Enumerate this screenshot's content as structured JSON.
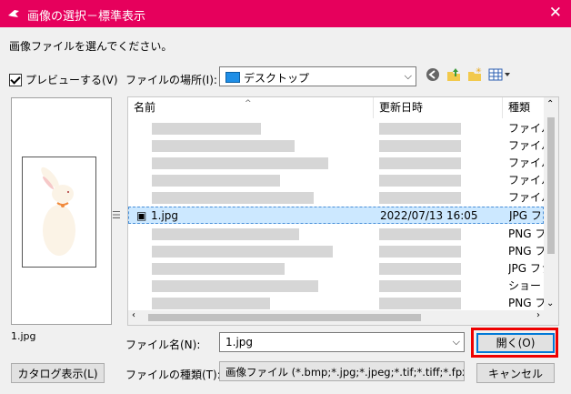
{
  "window": {
    "title": "画像の選択－標準表示",
    "close_glyph": "✕"
  },
  "instruction": "画像ファイルを選んでください。",
  "preview": {
    "checkbox_label": "プレビューする(V)",
    "file_name": "1.jpg"
  },
  "catalog_button": "カタログ表示(L)",
  "location": {
    "label": "ファイルの場所(I):",
    "value": "デスクトップ"
  },
  "toolbar_icons": [
    "back-icon",
    "up-folder-icon",
    "new-folder-icon",
    "view-menu-icon"
  ],
  "columns": {
    "name": "名前",
    "modified": "更新日時",
    "type": "種類"
  },
  "rows": [
    {
      "name": "",
      "date": "",
      "type": "ファイル"
    },
    {
      "name": "",
      "date": "",
      "type": "ファイル"
    },
    {
      "name": "",
      "date": "",
      "type": "ファイル"
    },
    {
      "name": "",
      "date": "",
      "type": "ファイル"
    },
    {
      "name": "",
      "date": "",
      "type": "ファイル"
    },
    {
      "name": "1.jpg",
      "date": "2022/07/13 16:05",
      "type": "JPG ファ"
    },
    {
      "name": "",
      "date": "",
      "type": "PNG フ"
    },
    {
      "name": "",
      "date": "",
      "type": "PNG フ"
    },
    {
      "name": "",
      "date": "",
      "type": "JPG ファ"
    },
    {
      "name": "",
      "date": "",
      "type": "ショート"
    },
    {
      "name": "",
      "date": "",
      "type": "PNG フ"
    }
  ],
  "selected_row": 5,
  "file_name": {
    "label": "ファイル名(N):",
    "value": "1.jpg"
  },
  "file_type": {
    "label": "ファイルの種類(T):",
    "value": "画像ファイル (*.bmp;*.jpg;*.jpeg;*.tif;*.tiff;*.fpx;*."
  },
  "buttons": {
    "open": "開く(O)",
    "cancel": "キャンセル"
  },
  "colors": {
    "titlebar": "#e6005c",
    "selection": "#cce8ff",
    "highlight": "#ee0000"
  }
}
